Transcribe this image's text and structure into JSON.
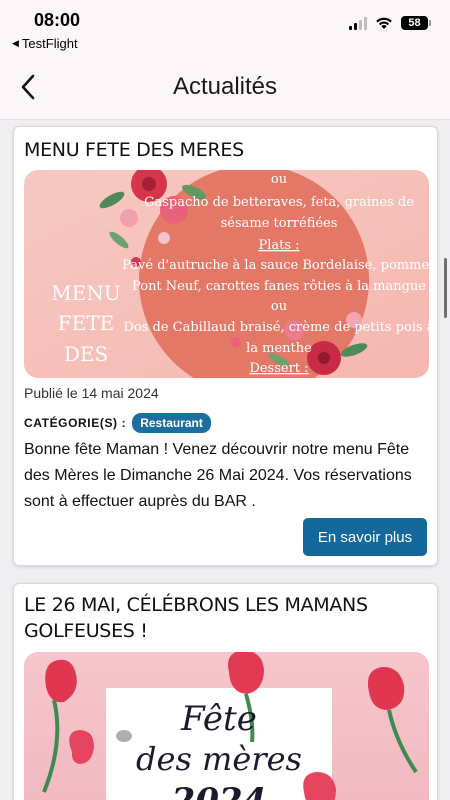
{
  "status_bar": {
    "time": "08:00",
    "back_app": "TestFlight",
    "battery": "58"
  },
  "nav": {
    "title": "Actualités",
    "back_icon": "chevron-left-icon"
  },
  "articles": [
    {
      "title": "MENU FETE DES MERES",
      "image_text": {
        "menu_lines": [
          "ou",
          "Gaspacho de betteraves, feta, graines de",
          "sésame torréfiées",
          "Plats :",
          "Pavé d'autruche à la sauce Bordelaise, pommes",
          "Pont Neuf, carottes fanes rôties à la mangue",
          "ou",
          "Dos de Cabillaud braisé, crème de petits pois à",
          "la menthe",
          "Dessert :"
        ],
        "side_lines": [
          "MENU",
          "FETE",
          "DES"
        ]
      },
      "published": "Publié le 14 mai 2024",
      "category_label": "CATÉGORIE(S) :",
      "category": "Restaurant",
      "text": "Bonne fête Maman ! Venez découvrir notre menu Fête des Mères le Dimanche 26 Mai 2024. Vos réservations sont à effectuer auprès du BAR .",
      "button": "En savoir plus"
    },
    {
      "title": "LE 26 MAI, CÉLÉBRONS LES MAMANS GOLFEUSES !",
      "image_text": {
        "line1": "Fête",
        "line2": "des mères",
        "line3": "2024"
      }
    }
  ],
  "colors": {
    "accent": "#14689a",
    "badge": "#1a6fa0",
    "header_bg": "#fcf6f9",
    "page_bg": "#efeef0"
  }
}
